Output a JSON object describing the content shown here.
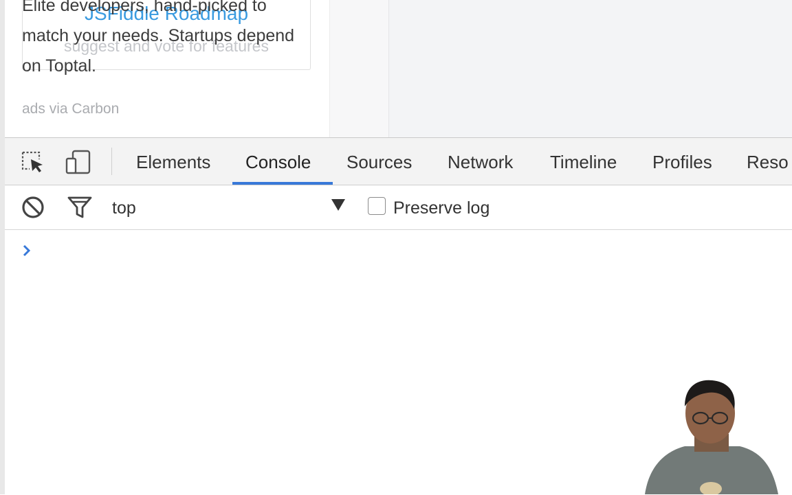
{
  "page": {
    "roadmap_title": "JSFiddle Roadmap",
    "roadmap_subtitle": "suggest and vote for features",
    "ad_text": "Elite developers, hand-picked to match your needs. Startups depend on Toptal.",
    "ad_via": "ads via Carbon"
  },
  "devtools": {
    "tabs": [
      {
        "label": "Elements",
        "active": false
      },
      {
        "label": "Console",
        "active": true
      },
      {
        "label": "Sources",
        "active": false
      },
      {
        "label": "Network",
        "active": false
      },
      {
        "label": "Timeline",
        "active": false
      },
      {
        "label": "Profiles",
        "active": false
      },
      {
        "label": "Reso",
        "active": false
      }
    ],
    "toolbar_icons": [
      "inspect-element-icon",
      "device-mode-icon"
    ],
    "console": {
      "clear_icon": "clear-console-icon",
      "filter_icon": "filter-icon",
      "context": "top",
      "preserve_log_label": "Preserve log",
      "preserve_log_checked": false,
      "prompt_icon": "chevron-right-icon"
    },
    "accent_color": "#3879d9"
  }
}
